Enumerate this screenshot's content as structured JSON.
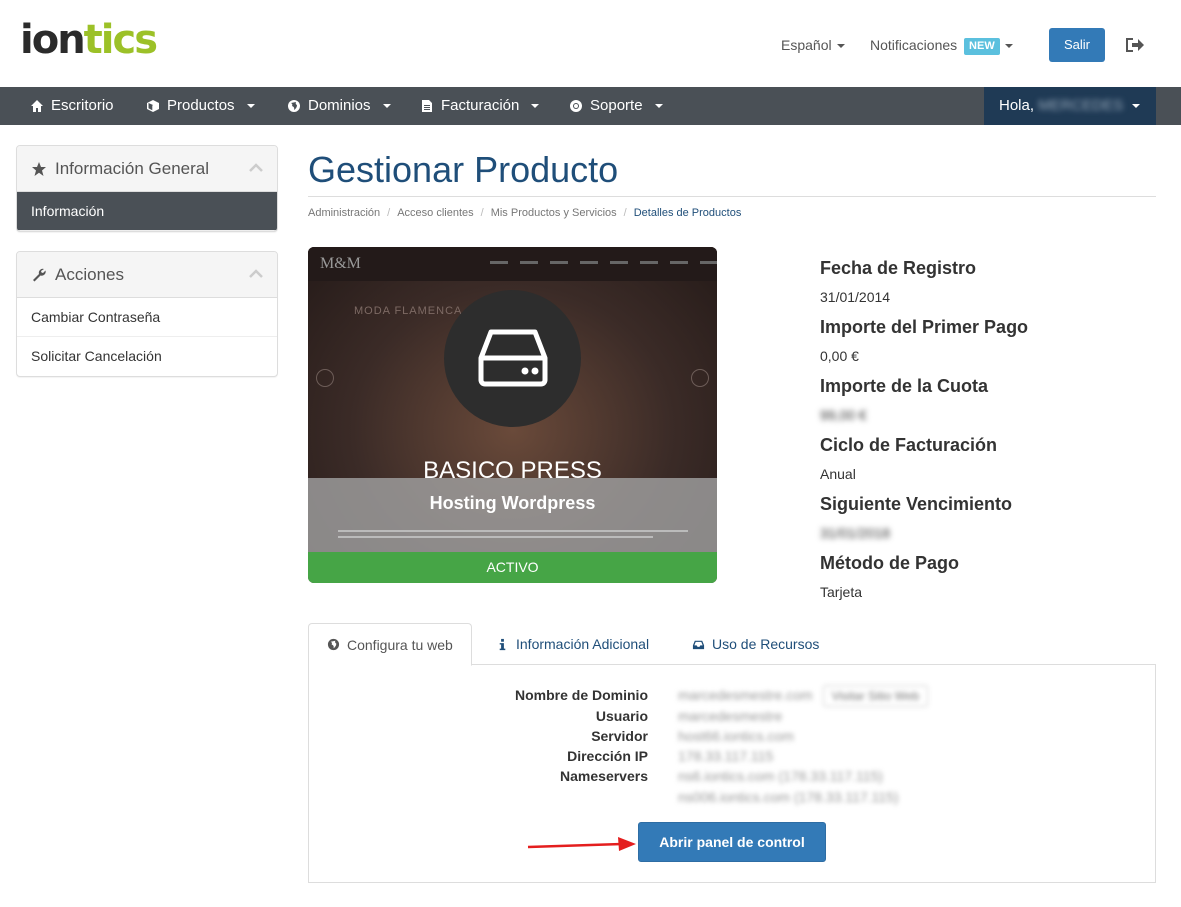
{
  "header": {
    "logo_part1": "ion",
    "logo_part2": "tics",
    "language": "Español",
    "notifications": "Notificaciones",
    "notifications_badge": "NEW",
    "logout_button": "Salir",
    "logout_icon": "sign-out-icon"
  },
  "navbar": {
    "items": [
      {
        "label": "Escritorio",
        "icon": "home-icon",
        "dropdown": false
      },
      {
        "label": "Productos",
        "icon": "cube-icon",
        "dropdown": true
      },
      {
        "label": "Dominios",
        "icon": "globe-icon",
        "dropdown": true
      },
      {
        "label": "Facturación",
        "icon": "file-icon",
        "dropdown": true
      },
      {
        "label": "Soporte",
        "icon": "life-ring-icon",
        "dropdown": true
      }
    ],
    "greeting": "Hola,",
    "user_name": "MERCEDES"
  },
  "sidebar": {
    "general_panel": {
      "title": "Información General",
      "items": [
        "Información"
      ]
    },
    "actions_panel": {
      "title": "Acciones",
      "items": [
        "Cambiar Contraseña",
        "Solicitar Cancelación"
      ]
    }
  },
  "main": {
    "title": "Gestionar Producto",
    "breadcrumb": [
      "Administración",
      "Acceso clientes",
      "Mis Productos y Servicios",
      "Detalles de Productos"
    ],
    "product": {
      "name": "BASICO PRESS",
      "type": "Hosting Wordpress",
      "status": "ACTIVO",
      "preview_logo": "M&M",
      "preview_text": "MODA FLAMENCA"
    },
    "details": [
      {
        "label": "Fecha de Registro",
        "value": "31/01/2014"
      },
      {
        "label": "Importe del Primer Pago",
        "value": "0,00 €"
      },
      {
        "label": "Importe de la Cuota",
        "value": "99,00 €"
      },
      {
        "label": "Ciclo de Facturación",
        "value": "Anual"
      },
      {
        "label": "Siguiente Vencimiento",
        "value": "31/01/2018"
      },
      {
        "label": "Método de Pago",
        "value": "Tarjeta"
      }
    ],
    "tabs": [
      "Configura tu web",
      "Información Adicional",
      "Uso de Recursos"
    ],
    "hosting_info": {
      "domain_label": "Nombre de Dominio",
      "domain_value": "marcedesmestre.com",
      "visit_button": "Visitar Sitio Web",
      "user_label": "Usuario",
      "user_value": "marcedesmestre",
      "server_label": "Servidor",
      "server_value": "host66.iontics.com",
      "ip_label": "Dirección IP",
      "ip_value": "178.33.117.115",
      "ns_label": "Nameservers",
      "ns1_value": "ns6.iontics.com (178.33.117.115)",
      "ns2_value": "ns006.iontics.com (178.33.117.115)"
    },
    "control_panel_button": "Abrir panel de control"
  },
  "colors": {
    "navbar_bg": "#4a5056",
    "user_menu_bg": "#1f3a55",
    "primary": "#337ab7",
    "status_active": "#46a546",
    "logo_green": "#9cc128",
    "title_blue": "#1f4e79",
    "annotation_arrow": "#e41e1e"
  }
}
